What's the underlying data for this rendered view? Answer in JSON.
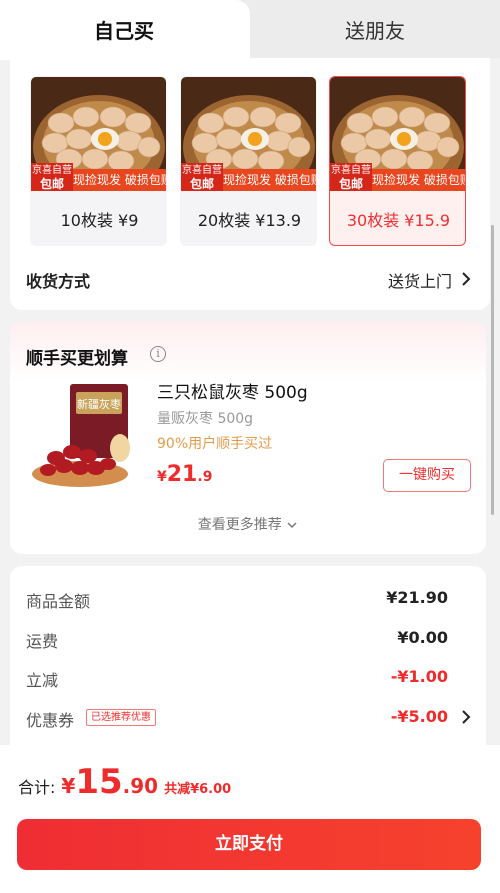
{
  "tabs": {
    "buy_self": "自己买",
    "send_friend": "送朋友"
  },
  "products": [
    {
      "label": "10枚装 ¥9",
      "selected": false
    },
    {
      "label": "20枚装 ¥13.9",
      "selected": false
    },
    {
      "label": "30枚装 ¥15.9",
      "selected": true
    }
  ],
  "promo": {
    "badge_top": "京喜自营",
    "badge_main": "包邮",
    "banner": "现捡现发 破损包赔"
  },
  "shipping": {
    "label": "收货方式",
    "value": "送货上门"
  },
  "recommend": {
    "title": "顺手买更划算",
    "name": "三只松鼠灰枣 500g",
    "spec": "量贩灰枣 500g",
    "social_proof": "90%用户顺手买过",
    "price_currency": "¥",
    "price_int": "21",
    "price_dec": ".9",
    "buy_button": "一键购买",
    "more_link": "查看更多推荐",
    "image_text": "新疆灰枣"
  },
  "fees": {
    "goods_label": "商品金额",
    "goods_value": "¥21.90",
    "freight_label": "运费",
    "freight_value": "¥0.00",
    "discount_label": "立减",
    "discount_value": "-¥1.00",
    "coupon_label": "优惠券",
    "coupon_tag": "已选推荐优惠",
    "coupon_value": "-¥5.00"
  },
  "footer": {
    "total_label": "合计:",
    "currency": "¥",
    "total_int": "15",
    "total_dec": ".90",
    "saved": "共减¥6.00",
    "pay_button": "立即支付"
  },
  "colors": {
    "accent": "#ef2b2b",
    "social": "#e39c4b"
  }
}
